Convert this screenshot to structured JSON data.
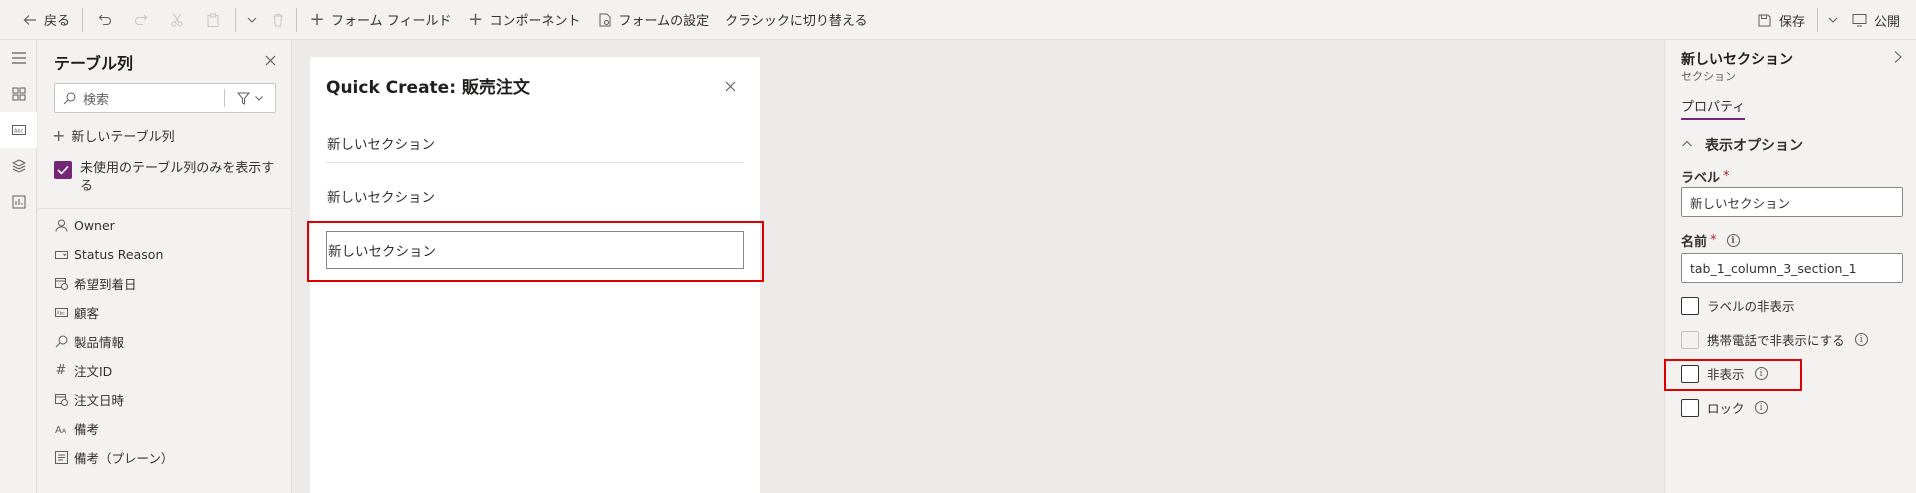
{
  "toolbar": {
    "back_label": "戻る",
    "add_field_label": "フォーム フィールド",
    "add_component_label": "コンポーネント",
    "form_settings_label": "フォームの設定",
    "switch_classic_label": "クラシックに切り替える",
    "save_label": "保存",
    "publish_label": "公開"
  },
  "columns_pane": {
    "title": "テーブル列",
    "search_placeholder": "検索",
    "new_column_label": "新しいテーブル列",
    "show_unused_label": "未使用のテーブル列のみを表示する",
    "show_unused_checked": true,
    "items": [
      {
        "label": "Owner",
        "icon": "person-icon"
      },
      {
        "label": "Status Reason",
        "icon": "option-set-icon"
      },
      {
        "label": "希望到着日",
        "icon": "calendar-clock-icon"
      },
      {
        "label": "顧客",
        "icon": "text-field-icon"
      },
      {
        "label": "製品情報",
        "icon": "lookup-icon"
      },
      {
        "label": "注文ID",
        "icon": "number-icon"
      },
      {
        "label": "注文日時",
        "icon": "calendar-clock-icon"
      },
      {
        "label": "備考",
        "icon": "rich-text-icon"
      },
      {
        "label": "備考（プレーン）",
        "icon": "multiline-text-icon"
      }
    ]
  },
  "form": {
    "title": "Quick Create: 販売注文",
    "sections": [
      "新しいセクション",
      "新しいセクション",
      "新しいセクション"
    ]
  },
  "properties": {
    "title": "新しいセクション",
    "subtitle": "セクション",
    "tab_label": "プロパティ",
    "display_options_label": "表示オプション",
    "label_field_label": "ラベル",
    "label_field_value": "新しいセクション",
    "name_field_label": "名前",
    "name_field_value": "tab_1_column_3_section_1",
    "hide_label_label": "ラベルの非表示",
    "hide_on_phone_label": "携帯電話で非表示にする",
    "hidden_label": "非表示",
    "lock_label": "ロック"
  },
  "colors": {
    "accent": "#742774",
    "highlight": "#e00000"
  }
}
